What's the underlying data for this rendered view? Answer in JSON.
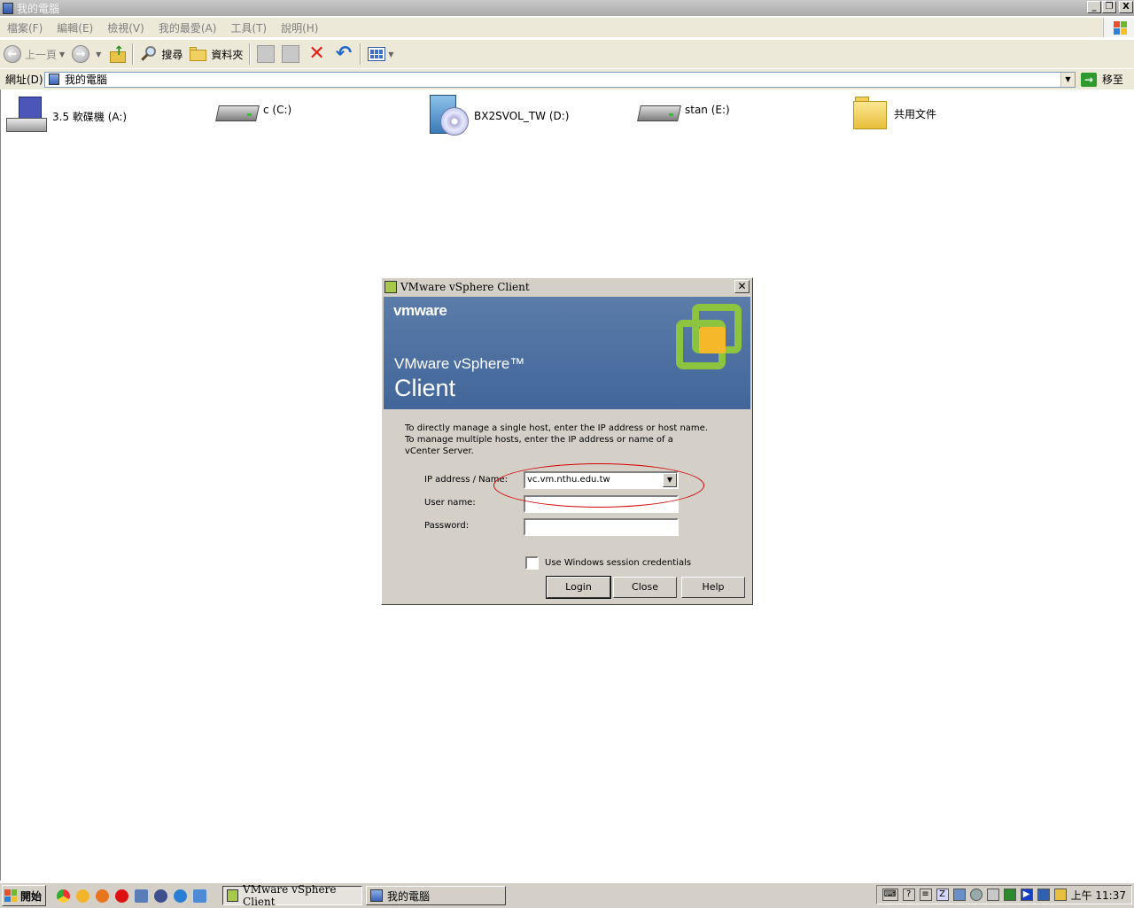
{
  "window": {
    "title": "我的電腦",
    "controls": {
      "minimize": "_",
      "restore": "❐",
      "close": "X"
    }
  },
  "menu": [
    "檔案(F)",
    "編輯(E)",
    "檢視(V)",
    "我的最愛(A)",
    "工具(T)",
    "說明(H)"
  ],
  "toolbar": {
    "back_label": "上一頁",
    "search_label": "搜尋",
    "folders_label": "資料夾"
  },
  "address": {
    "label": "網址(D)",
    "value": "我的電腦",
    "go_label": "移至"
  },
  "drives": [
    {
      "label": "3.5 軟碟機 (A:)",
      "icon": "floppy-drive-icon"
    },
    {
      "label": "c (C:)",
      "icon": "hard-drive-icon"
    },
    {
      "label": "BX2SVOL_TW (D:)",
      "icon": "cd-drive-icon"
    },
    {
      "label": "stan (E:)",
      "icon": "hard-drive-icon"
    },
    {
      "label": "共用文件",
      "icon": "shared-folder-icon"
    }
  ],
  "dialog": {
    "title": "VMware vSphere Client",
    "brand": "vmware",
    "product_name": "VMware vSphere™",
    "product_client": "Client",
    "intro_line1": "To directly manage a single host, enter the IP address or host name.",
    "intro_line2": "To manage multiple hosts, enter the IP address or name of a",
    "intro_line3": "vCenter Server.",
    "ip_label": "IP address / Name:",
    "ip_value": "vc.vm.nthu.edu.tw",
    "user_label": "User name:",
    "user_value": "",
    "password_label": "Password:",
    "password_value": "",
    "session_checkbox_label": "Use Windows session credentials",
    "session_checked": false,
    "login_label": "Login",
    "close_label": "Close",
    "help_label": "Help"
  },
  "taskbar": {
    "start_label": "開始",
    "tasks": [
      "VMware vSphere Client",
      "我的電腦"
    ],
    "clock": "上午 11:37"
  },
  "colors": {
    "banner": "#4a6d9f",
    "vmware_green": "#8cc43f",
    "vmware_orange": "#f5b82a",
    "annotation": "#d40000"
  }
}
